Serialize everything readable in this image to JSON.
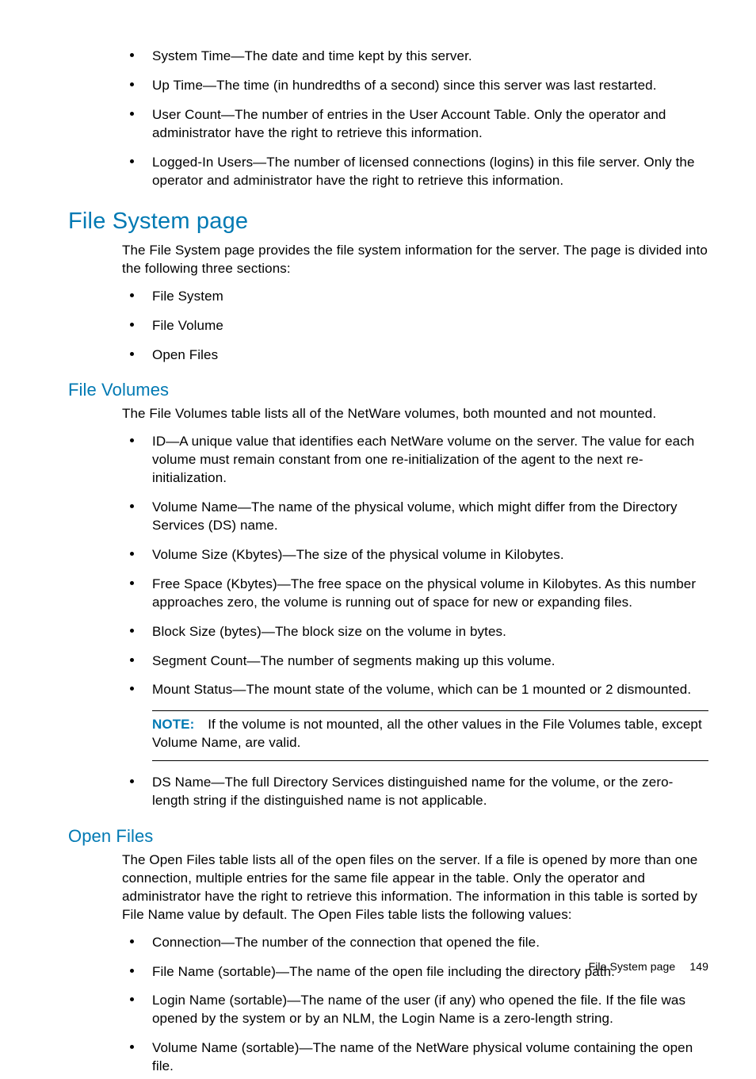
{
  "topList": [
    "System Time—The date and time kept by this server.",
    "Up Time—The time (in hundredths of a second) since this server was last restarted.",
    "User Count—The number of entries in the User Account Table. Only the operator and administrator have the right to retrieve this information.",
    "Logged-In Users—The number of licensed connections (logins) in this file server. Only the operator and administrator have the right to retrieve this information."
  ],
  "fileSystem": {
    "heading": "File System page",
    "intro": "The File System page provides the file system information for the server. The page is divided into the following three sections:",
    "items": [
      "File System",
      "File Volume",
      "Open Files"
    ]
  },
  "fileVolumes": {
    "heading": "File Volumes",
    "intro": "The File Volumes table lists all of the NetWare volumes, both mounted and not mounted.",
    "items": [
      "ID—A unique value that identifies each NetWare volume on the server. The value for each volume must remain constant from one re-initialization of the agent to the next re-initialization.",
      "Volume Name—The name of the physical volume, which might differ from the Directory Services (DS) name.",
      "Volume Size (Kbytes)—The size of the physical volume in Kilobytes.",
      "Free Space (Kbytes)—The free space on the physical volume in Kilobytes. As this number approaches zero, the volume is running out of space for new or expanding files.",
      "Block Size (bytes)—The block size on the volume in bytes.",
      "Segment Count—The number of segments making up this volume.",
      "Mount Status—The mount state of the volume, which can be 1 mounted or 2 dismounted."
    ],
    "noteLabel": "NOTE:",
    "noteText": "If the volume is not mounted, all the other values in the File Volumes table, except Volume Name, are valid.",
    "afterNote": [
      "DS Name—The full Directory Services distinguished name for the volume, or the zero-length string if the distinguished name is not applicable."
    ]
  },
  "openFiles": {
    "heading": "Open Files",
    "intro": "The Open Files table lists all of the open files on the server. If a file is opened by more than one connection, multiple entries for the same file appear in the table. Only the operator and administrator have the right to retrieve this information. The information in this table is sorted by File Name value by default. The Open Files table lists the following values:",
    "items": [
      "Connection—The number of the connection that opened the file.",
      "File Name (sortable)—The name of the open file including the directory path.",
      "Login Name (sortable)—The name of the user (if any) who opened the file. If the file was opened by the system or by an NLM, the Login Name is a zero-length string.",
      "Volume Name (sortable)—The name of the NetWare physical volume containing the open file."
    ]
  },
  "footer": {
    "text": "File System page",
    "page": "149"
  }
}
